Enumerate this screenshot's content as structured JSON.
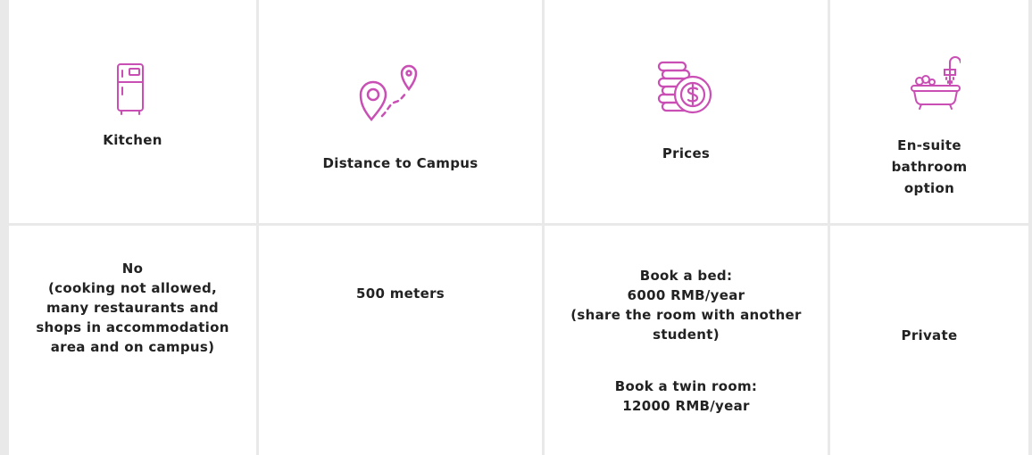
{
  "colors": {
    "accent": "#c94fb5",
    "border": "#e9e9e9",
    "text": "#222222"
  },
  "header": {
    "kitchen": {
      "icon": "fridge-icon",
      "label": "Kitchen"
    },
    "distance": {
      "icon": "route-pin-icon",
      "label": "Distance to Campus"
    },
    "prices": {
      "icon": "coins-dollar-icon",
      "label": "Prices"
    },
    "bathroom": {
      "icon": "bathtub-shower-icon",
      "lines": [
        "En-suite",
        "bathroom",
        "option"
      ]
    }
  },
  "row": {
    "kitchen": [
      "No",
      "(cooking not allowed,",
      "many restaurants and",
      "shops in accommodation",
      "area and on campus)"
    ],
    "distance": "500 meters",
    "prices_bed": [
      "Book a bed:",
      "6000 RMB/year",
      "(share the room with another",
      "student)"
    ],
    "prices_twin": [
      "Book a twin room:",
      "12000 RMB/year"
    ],
    "bathroom": "Private"
  }
}
